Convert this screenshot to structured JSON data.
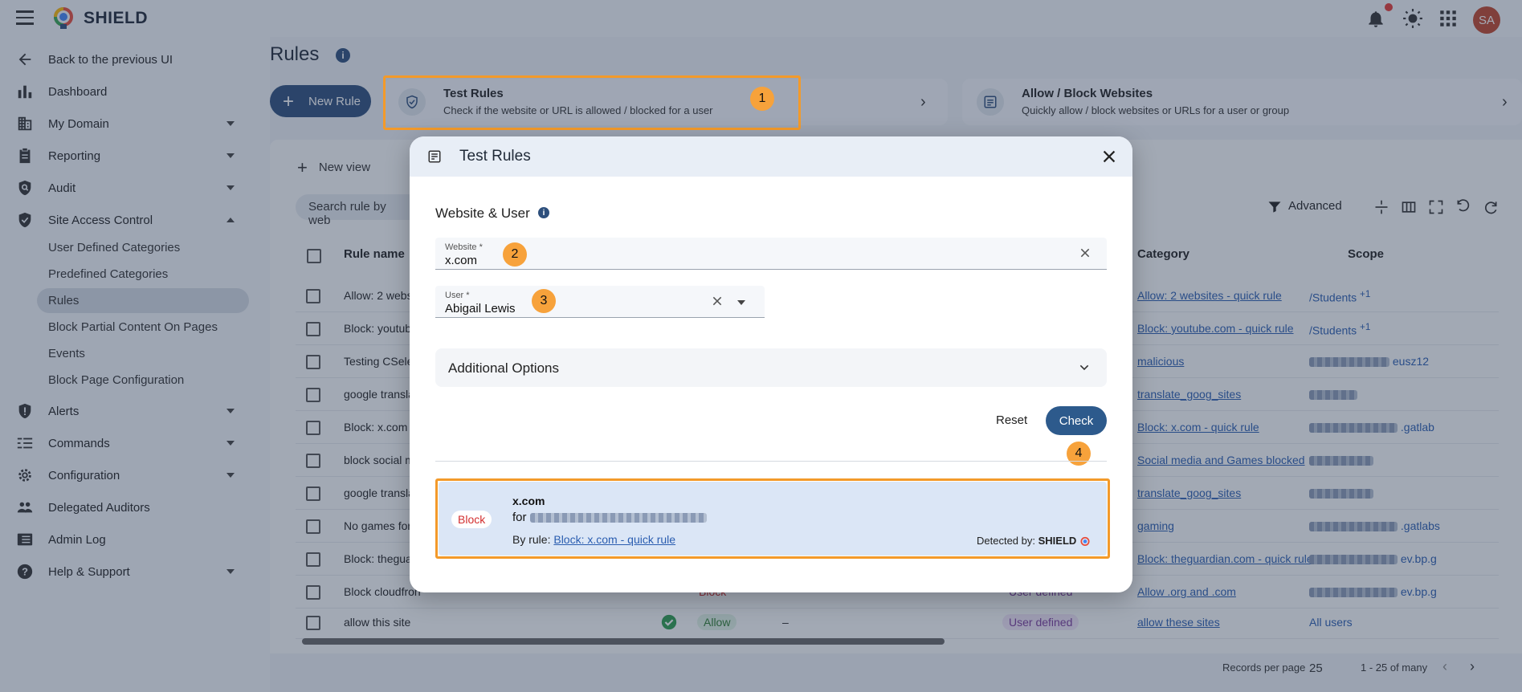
{
  "app": {
    "brand": "SHIELD",
    "avatar_initials": "SA"
  },
  "sidebar": {
    "items": [
      {
        "label": "Back to the previous UI",
        "icon": "arrow-left-icon"
      },
      {
        "label": "Dashboard",
        "icon": "bar-chart-icon"
      },
      {
        "label": "My Domain",
        "icon": "building-icon"
      },
      {
        "label": "Reporting",
        "icon": "clipboard-icon"
      },
      {
        "label": "Audit",
        "icon": "shield-search-icon"
      },
      {
        "label": "Site Access Control",
        "icon": "shield-icon"
      },
      {
        "label": "Alerts",
        "icon": "alert-shield-icon"
      },
      {
        "label": "Commands",
        "icon": "commands-icon"
      },
      {
        "label": "Configuration",
        "icon": "gear-icon"
      },
      {
        "label": "Delegated Auditors",
        "icon": "people-icon"
      },
      {
        "label": "Admin Log",
        "icon": "log-icon"
      },
      {
        "label": "Help & Support",
        "icon": "help-icon"
      }
    ],
    "sub_items": [
      "User Defined Categories",
      "Predefined Categories",
      "Rules",
      "Block Partial Content On Pages",
      "Events",
      "Block Page Configuration"
    ]
  },
  "page": {
    "title": "Rules",
    "new_rule_label": "New Rule",
    "cards": [
      {
        "title": "Test Rules",
        "desc": "Check if the website or URL is allowed / blocked for a user"
      },
      {
        "title": "Allow / Block Websites",
        "desc": "Quickly allow / block websites or URLs for a user or group"
      }
    ],
    "new_view_label": "New view",
    "search_placeholder": "Search rule by web",
    "advanced_label": "Advanced",
    "columns": {
      "rule_name": "Rule name",
      "category": "Category",
      "scope": "Scope"
    },
    "rows": [
      {
        "name": "Allow: 2 webs",
        "category": "Allow: 2 websites - quick rule",
        "scope": "/Students",
        "scope_extra": "+1"
      },
      {
        "name": "Block: youtub",
        "category": "Block: youtube.com - quick rule",
        "scope": "/Students",
        "scope_extra": "+1"
      },
      {
        "name": "Testing CSele",
        "category": "malicious",
        "scope": "eusz12"
      },
      {
        "name": "google transla",
        "category": "translate_goog_sites",
        "scope": ""
      },
      {
        "name": "Block: x.com",
        "category": "Block: x.com - quick rule",
        "scope": ".gatlab"
      },
      {
        "name": "block social m",
        "category": "Social media and Games blocked",
        "scope": ""
      },
      {
        "name": "google transla",
        "category": "translate_goog_sites",
        "scope": ""
      },
      {
        "name": "No games for",
        "category": "gaming",
        "scope": ".gatlabs"
      },
      {
        "name": "Block: thegua",
        "category": "Block: theguardian.com - quick rule",
        "scope": "ev.bp.g"
      },
      {
        "name": "Block cloudfron",
        "category": "Allow .org and .com",
        "scope": "ev.bp.g",
        "status": "Block",
        "type": "User defined"
      },
      {
        "name": "allow this site",
        "category": "allow these sites",
        "scope": "All users",
        "status": "Allow",
        "dash": "–",
        "type": "User defined"
      }
    ],
    "footer": {
      "records_label": "Records per page",
      "per_page": "25",
      "range": "1 - 25 of many"
    }
  },
  "modal": {
    "title": "Test Rules",
    "section": "Website & User",
    "website": {
      "label": "Website *",
      "value": "x.com"
    },
    "user": {
      "label": "User *",
      "value": "Abigail Lewis"
    },
    "additional_options": "Additional Options",
    "reset_label": "Reset",
    "check_label": "Check",
    "result": {
      "badge": "Block",
      "site": "x.com",
      "for_prefix": "for",
      "by_rule_prefix": "By rule:",
      "rule_link": "Block: x.com - quick rule",
      "detected_prefix": "Detected by:",
      "detected_brand": "SHIELD"
    }
  },
  "annotations": {
    "steps": [
      "1",
      "2",
      "3",
      "4"
    ],
    "highlight_color": "#f39a2a"
  }
}
